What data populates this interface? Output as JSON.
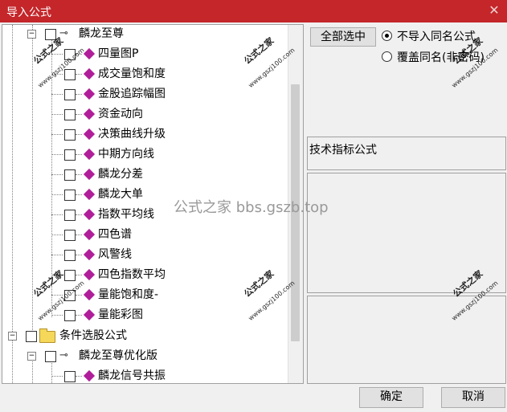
{
  "window": {
    "title": "导入公式",
    "close_label": "✕"
  },
  "tree": {
    "items": [
      {
        "label": "麟龙至尊",
        "type": "group"
      },
      {
        "label": "四量图P",
        "type": "formula"
      },
      {
        "label": "成交量饱和度",
        "type": "formula"
      },
      {
        "label": "金股追踪幅图",
        "type": "formula"
      },
      {
        "label": "资金动向",
        "type": "formula"
      },
      {
        "label": "决策曲线升级",
        "type": "formula"
      },
      {
        "label": "中期方向线",
        "type": "formula"
      },
      {
        "label": "麟龙分差",
        "type": "formula"
      },
      {
        "label": "麟龙大单",
        "type": "formula"
      },
      {
        "label": "指数平均线",
        "type": "formula"
      },
      {
        "label": "四色谱",
        "type": "formula"
      },
      {
        "label": "风警线",
        "type": "formula"
      },
      {
        "label": "四色指数平均",
        "type": "formula"
      },
      {
        "label": "量能饱和度-",
        "type": "formula"
      },
      {
        "label": "量能彩图",
        "type": "formula"
      },
      {
        "label": "条件选股公式",
        "type": "folder"
      },
      {
        "label": "麟龙至尊优化版",
        "type": "group"
      },
      {
        "label": "麟龙信号共振",
        "type": "formula"
      }
    ]
  },
  "right_panel": {
    "select_all_label": "全部选中",
    "radio_options": [
      {
        "label": "不导入同名公式",
        "selected": true
      },
      {
        "label": "覆盖同名(非密码)",
        "selected": false
      }
    ],
    "description": "技术指标公式"
  },
  "footer": {
    "ok_label": "确定",
    "cancel_label": "取消"
  },
  "watermark": {
    "center_text": "公式之家 bbs.gszb.top",
    "stamp_text": "公式之家",
    "stamp_url": "www.gszj100.com"
  },
  "colors": {
    "titlebar": "#c4262a",
    "formula_icon": "#b01e9a",
    "folder_icon": "#f5d75a"
  }
}
